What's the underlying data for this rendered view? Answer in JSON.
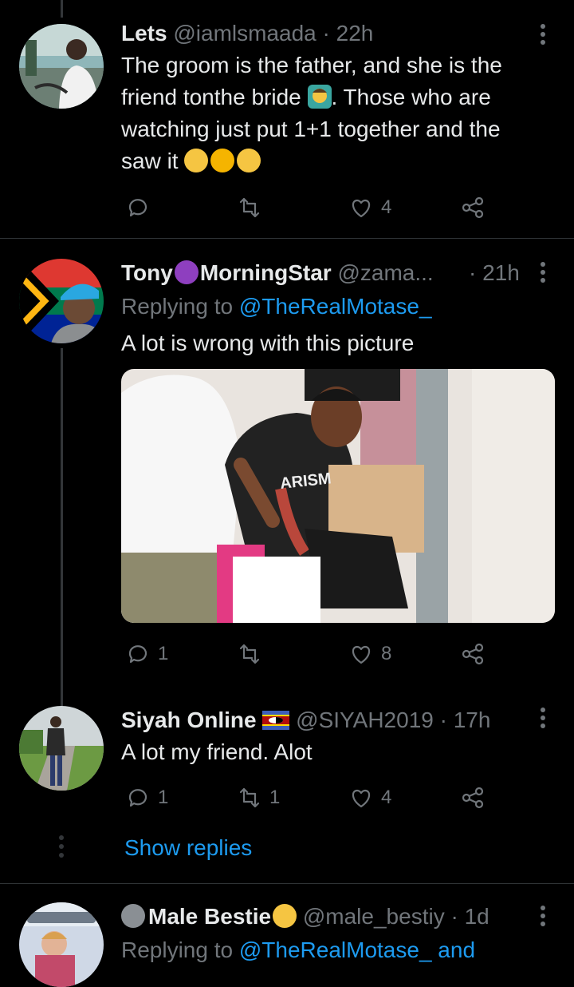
{
  "tweet1": {
    "name": "Lets",
    "handle": "@iamlsmaada",
    "dot": "·",
    "time": "22h",
    "text_l1": "The groom is the father, and she is the",
    "text_l2a": "friend tonthe bride",
    "text_l2b": ". Those who are",
    "text_l3": "watching just put 1+1 together and the",
    "text_l4": "saw it",
    "likes": "4"
  },
  "tweet2": {
    "name_a": "Tony",
    "name_b": "MorningStar",
    "handle": "@zama...",
    "time": "· 21h",
    "replying_prefix": "Replying to ",
    "replying_to": "@TheRealMotase_",
    "text": "A lot is wrong with this picture",
    "image_text": "ARISM",
    "replies": "1",
    "likes": "8"
  },
  "tweet3": {
    "name": "Siyah Online",
    "handle": "@SIYAH2019",
    "dot": "·",
    "time": "17h",
    "text": "A lot my friend. Alot",
    "replies": "1",
    "retweets": "1",
    "likes": "4"
  },
  "show_replies": "Show replies",
  "tweet4": {
    "name": "Male Bestie",
    "handle": "@male_bestiy",
    "dot": "·",
    "time": "1d",
    "replying_prefix": "Replying to ",
    "replying_to": "@TheRealMotase_ and"
  },
  "colors": {
    "accent": "#1d9bf0",
    "secondary": "#71767b",
    "text": "#e7e9ea",
    "background": "#000000"
  },
  "icons": [
    "reply-icon",
    "retweet-icon",
    "like-icon",
    "share-icon",
    "more-icon"
  ]
}
